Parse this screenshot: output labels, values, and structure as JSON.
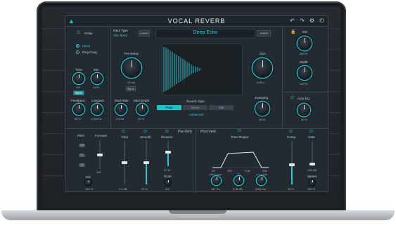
{
  "plugin": {
    "title": "VOCAL REVERB",
    "input_type_label": "Input Type",
    "input_type_value": "Alto Tenor",
    "learn_label": "Learn",
    "preset_name": "Deep Echo",
    "assist_label": "Assist"
  },
  "delay": {
    "label": "Delay",
    "mode_mono": "Mono",
    "mode_pingpong": "Ping Pong",
    "time_label": "Time",
    "time_value": "1/4",
    "sync_label": "Sync",
    "mix_label": "Mix",
    "mix_value": "10 %",
    "feedback_label": "Feedback",
    "feedback_value": "55 %",
    "lowpass_label": "Lowpass",
    "lowpass_value": "3,000 Hz"
  },
  "reverb": {
    "predelay_label": "Pre-Delay",
    "predelay_value": "10 ms",
    "predelay_sync": "Sync",
    "size_label": "Size",
    "size_value": "4.00 s",
    "modrate_label": "Mod Rate",
    "modrate_value": "2.5 Hz",
    "moddepth_label": "Mod Depth",
    "moddepth_value": "20 %",
    "style_label": "Reverb Style",
    "style_options": [
      "Plate",
      "Room",
      "Hall"
    ],
    "advanced_label": "Advanced",
    "damping_label": "Damping",
    "damping_value": "25 %"
  },
  "right": {
    "mix_label": "Mix",
    "mix_value": "100 %",
    "width_label": "Width",
    "width_value": "100 %",
    "autoeq_label": "Auto-EQ",
    "autoeq_value": "40 %"
  },
  "preverb": {
    "section_label": "Pre-Verb",
    "pitch_label": "Pitch",
    "formant_label": "Formant",
    "formant_value": "100",
    "pitch_pills": [
      "+12",
      "0",
      "-12"
    ],
    "mix_label": "Mix",
    "mix_value": "100 %",
    "tube_label": "Tube",
    "tube_value": "0.0 dB",
    "smooth_label": "Smooth",
    "smooth_value": "50 %",
    "reverse_label": "Reverse",
    "reverse_value": "57 %",
    "node_label": "Node",
    "node_value": "1/4"
  },
  "postverb": {
    "section_label": "Post-Verb",
    "toneshaper_label": "Tone Shaper",
    "axis_ticks": [
      "20",
      "250",
      "2.5k",
      "20k"
    ],
    "highpass_label": "Highpass",
    "highpass_value": "187 Hz",
    "tilt_label": "Tilt",
    "tilt_value": "0.98 dB",
    "lowpass_label": "Lowpass",
    "lowpass_value": "4902 Hz",
    "comp_label": "Comp",
    "comp_value": "46 %",
    "gate_label": "Gate",
    "gate_value": "-100 dB",
    "speed_label": "Speed",
    "speed_value": "100 %"
  },
  "colors": {
    "accent": "#20c3c9",
    "panel": "#232a31"
  }
}
